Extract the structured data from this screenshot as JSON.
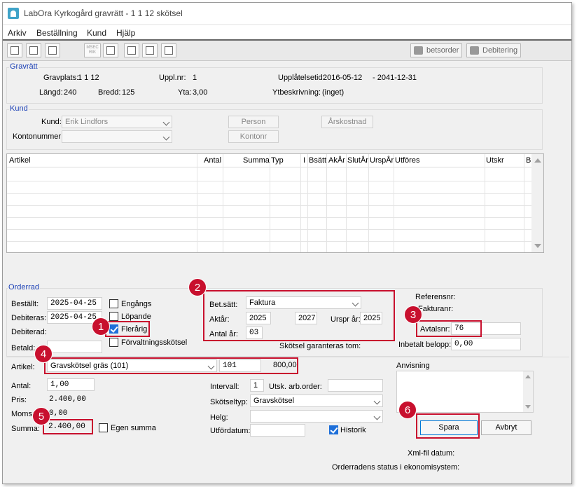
{
  "window": {
    "title": "LabOra Kyrkogård gravrätt - 1 1  12 skötsel"
  },
  "menu": [
    "Arkiv",
    "Beställning",
    "Kund",
    "Hjälp"
  ],
  "toolbar": {
    "small_button_text": "MSEC RIK",
    "betsorder_label": "betsorder",
    "debitering_label": "Debitering"
  },
  "gravratt": {
    "legend": "Gravrätt",
    "gravplats_label": "Gravplats:",
    "gravplats_value": "1 1  12",
    "upplnr_label": "Uppl.nr:",
    "upplnr_value": "1",
    "upplatelsetid_label": "Upplåtelsetid:",
    "upplatelsetid_from": "2016-05-12",
    "upplatelsetid_to": "- 2041-12-31",
    "langd_label": "Längd:",
    "langd_value": "240",
    "bredd_label": "Bredd:",
    "bredd_value": "125",
    "yta_label": "Yta:",
    "yta_value": "3,00",
    "ytbeskrivning_label": "Ytbeskrivning:",
    "ytbeskrivning_value": "(inget)"
  },
  "kund": {
    "legend": "Kund",
    "kund_label": "Kund:",
    "kund_value": "Erik  Lindfors",
    "kontonummer_label": "Kontonummer:",
    "kontonummer_value": "",
    "person_button": "Person",
    "kontonr_button": "Kontonr",
    "arskostnad_button": "Årskostnad"
  },
  "grid": {
    "columns": [
      "Artikel",
      "Antal",
      "Summa",
      "Typ",
      "I",
      "Bsätt",
      "AkÅr",
      "SlutÅr",
      "UrspÅr",
      "Utföres",
      "Utskr",
      "B"
    ]
  },
  "orderrad": {
    "legend": "Orderrad",
    "bestallt_label": "Beställt:",
    "bestallt_value": "2025-04-25",
    "debiteras_label": "Debiteras:",
    "debiteras_value": "2025-04-25",
    "debiterad_label": "Debiterad:",
    "betald_label": "Betald:",
    "betald_value": "",
    "engangs_label": "Engångs",
    "lopande_label": "Löpande",
    "flerarig_label": "Flerårig",
    "forvaltning_label": "Förvaltningsskötsel",
    "betsatt_label": "Bet.sätt:",
    "betsatt_value": "Faktura",
    "aktar_label": "Aktår:",
    "aktar_value": "2025",
    "aktar_to": "2027",
    "ursprar_label": "Urspr år:",
    "ursprar_value": "2025",
    "antalar_label": "Antal år:",
    "antalar_value": "03",
    "referensnr_label": "Referensnr:",
    "fakturanr_label": "Fakturanr:",
    "avtalsnr_label": "Avtalsnr:",
    "avtalsnr_value": "76",
    "inbetalt_label": "Inbetalt belopp:",
    "inbetalt_value": "0,00",
    "skotsel_garanteras": "Skötsel garanteras tom:",
    "artikel_label": "Artikel:",
    "artikel_value": "Gravskötsel gräs (101)",
    "artikel_code": "101",
    "artikel_price": "800,00",
    "anvisning_label": "Anvisning",
    "antal_label": "Antal:",
    "antal_value": "1,00",
    "pris_label": "Pris:",
    "pris_value": "2.400,00",
    "moms_label": "Moms:",
    "moms_value": "0,00",
    "summa_label": "Summa:",
    "summa_value": "2.400,00",
    "egen_summa_label": "Egen summa",
    "intervall_label": "Intervall:",
    "intervall_value": "1",
    "utsk_label": "Utsk. arb.order:",
    "utsk_value": "",
    "skotseltyp_label": "Skötseltyp:",
    "skotseltyp_value": "Gravskötsel",
    "helg_label": "Helg:",
    "helg_value": "",
    "utfordatum_label": "Utfördatum:",
    "utfordatum_value": "",
    "historik_label": "Historik",
    "spara_button": "Spara",
    "avbryt_button": "Avbryt",
    "xml_label": "Xml-fil datum:",
    "status_label": "Orderradens status i ekonomisystem:"
  },
  "callouts": [
    "1",
    "2",
    "3",
    "4",
    "5",
    "6"
  ],
  "colors": {
    "callout": "#c8102e",
    "legend": "#1a3fb5",
    "checkbox_on": "#1e6fd9"
  },
  "checkboxes": {
    "engangs": false,
    "lopande": false,
    "flerarig": true,
    "forvaltning": false,
    "egen_summa": false,
    "historik": true
  }
}
